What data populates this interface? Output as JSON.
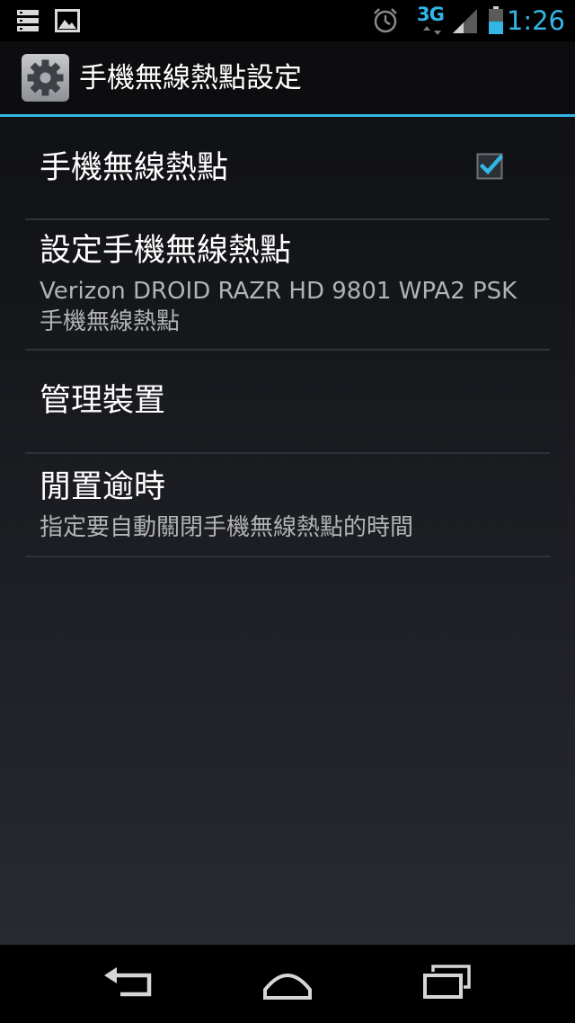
{
  "status_bar": {
    "time": "1:26",
    "network_type": "3G",
    "icons": [
      "notification-icon",
      "image-icon",
      "alarm-icon",
      "3g-data-icon",
      "signal-icon",
      "battery-icon"
    ],
    "accent_color": "#33b5e5"
  },
  "action_bar": {
    "title": "手機無線熱點設定",
    "icon": "settings-gear-icon"
  },
  "preferences": [
    {
      "title": "手機無線熱點",
      "checked": true
    },
    {
      "title": "設定手機無線熱點",
      "summary_line1": "Verizon DROID RAZR HD 9801 WPA2 PSK",
      "summary_line2": "手機無線熱點"
    },
    {
      "title": "管理裝置"
    },
    {
      "title": "閒置逾時",
      "summary": "指定要自動關閉手機無線熱點的時間"
    }
  ],
  "nav_bar": {
    "buttons": [
      "back-icon",
      "home-icon",
      "recent-apps-icon"
    ]
  }
}
